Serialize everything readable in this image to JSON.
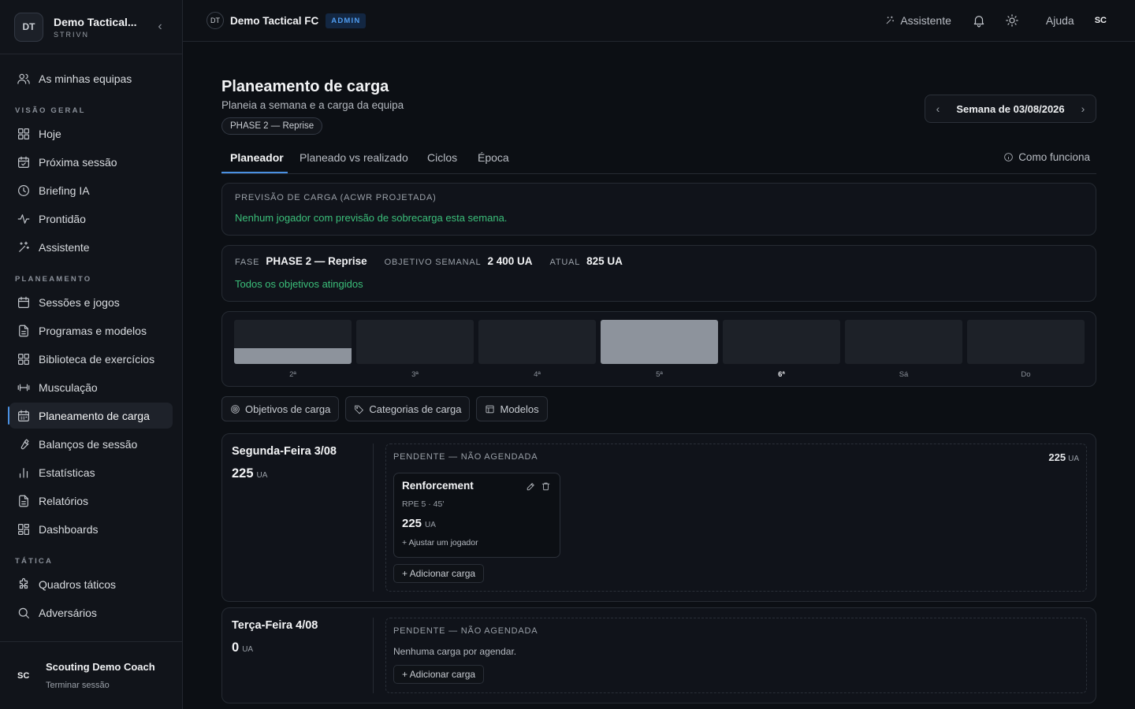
{
  "sidebar": {
    "logo": "DT",
    "team_name": "Demo Tactical...",
    "team_sub": "STRIVN",
    "collapse": "‹",
    "my_teams": "As minhas equipas",
    "sections": {
      "overview": "VISÃO GERAL",
      "planning": "PLANEAMENTO",
      "tactics": "TÁTICA"
    },
    "overview_items": [
      "Hoje",
      "Próxima sessão",
      "Briefing IA",
      "Prontidão",
      "Assistente"
    ],
    "planning_items": [
      "Sessões e jogos",
      "Programas e modelos",
      "Biblioteca de exercícios",
      "Musculação",
      "Planeamento de carga",
      "Balanços de sessão",
      "Estatísticas",
      "Relatórios",
      "Dashboards"
    ],
    "tactics_items": [
      "Quadros táticos",
      "Adversários"
    ],
    "user_initials": "SC",
    "user_name": "Scouting Demo Coach",
    "logout": "Terminar sessão"
  },
  "topbar": {
    "logo": "DT",
    "team": "Demo Tactical FC",
    "badge": "ADMIN",
    "assistant": "Assistente",
    "help": "Ajuda",
    "avatar": "SC"
  },
  "page": {
    "title": "Planeamento de carga",
    "subtitle": "Planeia a semana e a carga da equipa",
    "phase_pill": "PHASE 2 — Reprise",
    "week_prev": "‹",
    "week_label": "Semana de 03/08/2026",
    "week_next": "›",
    "tabs": [
      "Planeador",
      "Planeado vs realizado",
      "Ciclos",
      "Época"
    ],
    "help_link": "Como funciona"
  },
  "forecast": {
    "caption": "PREVISÃO DE CARGA (ACWR PROJETADA)",
    "message": "Nenhum jogador com previsão de sobrecarga esta semana."
  },
  "phase_card": {
    "phase_key": "FASE",
    "phase_val": "PHASE 2 — Reprise",
    "target_key": "OBJETIVO SEMANAL",
    "target_val": "2 400 UA",
    "current_key": "ATUAL",
    "current_val": "825 UA",
    "status": "Todos os objetivos atingidos"
  },
  "week_chart": {
    "days": [
      "2ª",
      "3ª",
      "4ª",
      "5ª",
      "6ª",
      "Sá",
      "Do"
    ],
    "today_index": 4,
    "fill_fraction": [
      0.36,
      0,
      0,
      1.0,
      0,
      0,
      0
    ]
  },
  "buttons": {
    "targets": "Objetivos de carga",
    "categories": "Categorias de carga",
    "templates": "Modelos"
  },
  "days": [
    {
      "name": "Segunda-Feira 3/08",
      "load": "225",
      "unit": "UA",
      "pending_caption": "PENDENTE — NÃO AGENDADA",
      "pending_total": "225",
      "session": {
        "title": "Renforcement",
        "meta": "RPE 5 · 45'",
        "load": "225",
        "unit": "UA",
        "adjust": "+ Ajustar um jogador"
      },
      "add": "+ Adicionar carga"
    },
    {
      "name": "Terça-Feira 4/08",
      "load": "0",
      "unit": "UA",
      "pending_caption": "PENDENTE — NÃO AGENDADA",
      "empty": "Nenhuma carga por agendar.",
      "add": "+ Adicionar carga"
    }
  ],
  "colors": {
    "accent": "#4a90e2",
    "success": "#3bbf7a",
    "bar_fill": "#8d939c"
  }
}
